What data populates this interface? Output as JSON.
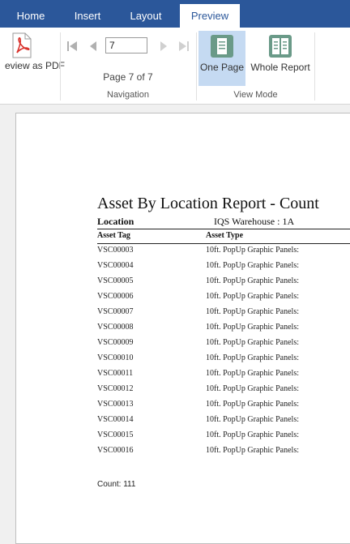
{
  "tabs": [
    {
      "label": "Home"
    },
    {
      "label": "Insert"
    },
    {
      "label": "Layout"
    },
    {
      "label": "Preview"
    }
  ],
  "ribbon": {
    "pdf_label": "eview as PDF",
    "navigation": {
      "page_value": "7",
      "page_status": "Page 7 of 7",
      "group_label": "Navigation"
    },
    "view_mode": {
      "one_page_label": "One Page",
      "whole_report_label": "Whole Report",
      "group_label": "View Mode"
    }
  },
  "report": {
    "title": "Asset By Location Report - Count",
    "location_label": "Location",
    "location_value": "IQS Warehouse : 1A",
    "columns": [
      "Asset Tag",
      "Asset Type"
    ],
    "rows": [
      {
        "tag": "VSC00003",
        "type": "10ft. PopUp Graphic Panels:"
      },
      {
        "tag": "VSC00004",
        "type": "10ft. PopUp Graphic Panels:"
      },
      {
        "tag": "VSC00005",
        "type": "10ft. PopUp Graphic Panels:"
      },
      {
        "tag": "VSC00006",
        "type": "10ft. PopUp Graphic Panels:"
      },
      {
        "tag": "VSC00007",
        "type": "10ft. PopUp Graphic Panels:"
      },
      {
        "tag": "VSC00008",
        "type": "10ft. PopUp Graphic Panels:"
      },
      {
        "tag": "VSC00009",
        "type": "10ft. PopUp Graphic Panels:"
      },
      {
        "tag": "VSC00010",
        "type": "10ft. PopUp Graphic Panels:"
      },
      {
        "tag": "VSC00011",
        "type": "10ft. PopUp Graphic Panels:"
      },
      {
        "tag": "VSC00012",
        "type": "10ft. PopUp Graphic Panels:"
      },
      {
        "tag": "VSC00013",
        "type": "10ft. PopUp Graphic Panels:"
      },
      {
        "tag": "VSC00014",
        "type": "10ft. PopUp Graphic Panels:"
      },
      {
        "tag": "VSC00015",
        "type": "10ft. PopUp Graphic Panels:"
      },
      {
        "tag": "VSC00016",
        "type": "10ft. PopUp Graphic Panels:"
      }
    ],
    "count_text": "Count: 111"
  },
  "colors": {
    "tabbar": "#2b579a",
    "selected_mode": "#c5daf2",
    "pdf_icon": "#d9322c",
    "view_icon": "#6a9a88"
  },
  "icons": [
    "pdf-icon",
    "first-page-icon",
    "previous-page-icon",
    "next-page-icon",
    "last-page-icon",
    "one-page-icon",
    "whole-report-icon"
  ]
}
